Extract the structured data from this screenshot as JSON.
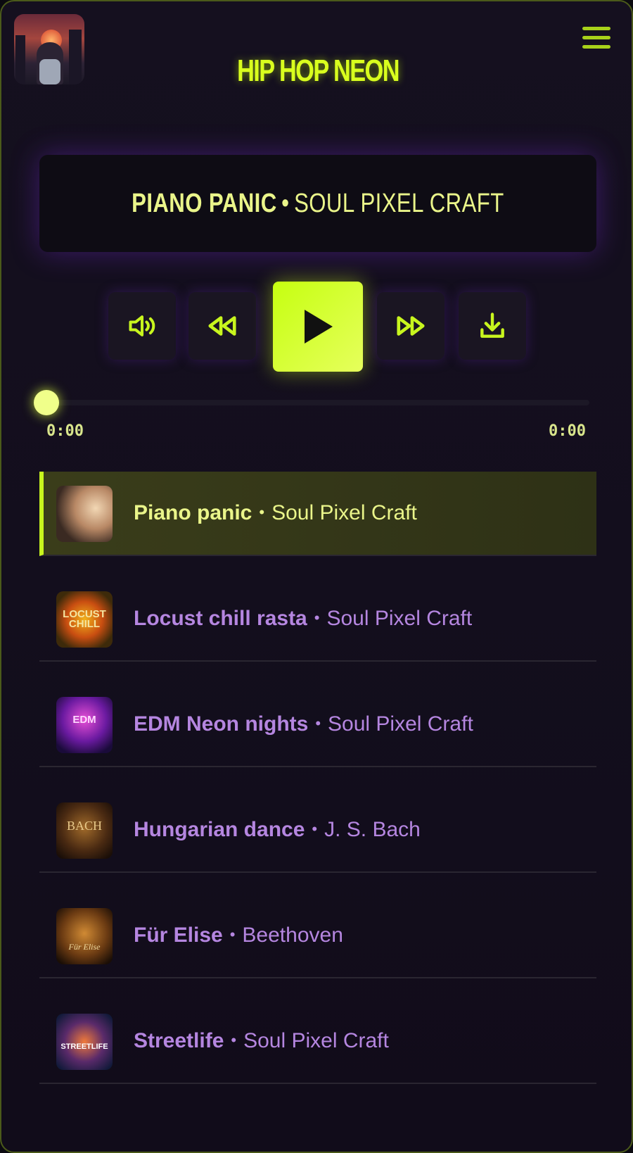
{
  "header": {
    "app_title": "HIP HOP NEON",
    "menu_icon": "hamburger-menu-icon",
    "avatar_icon": "album-art-city-girl"
  },
  "now_playing": {
    "title": "Piano panic",
    "separator": "•",
    "artist": "Soul Pixel Craft"
  },
  "controls": {
    "volume_icon": "volume-icon",
    "rewind_icon": "rewind-icon",
    "play_icon": "play-icon",
    "forward_icon": "fast-forward-icon",
    "download_icon": "download-icon",
    "accent": "#c8f51e"
  },
  "progress": {
    "elapsed": "0:00",
    "duration": "0:00",
    "fraction": 0
  },
  "playlist": [
    {
      "title": "Piano panic",
      "artist": "Soul Pixel Craft",
      "separator": "•",
      "active": true,
      "cover_text": ""
    },
    {
      "title": "Locust chill rasta",
      "artist": "Soul Pixel Craft",
      "separator": "•",
      "active": false,
      "cover_text": "LOCUST CHILL"
    },
    {
      "title": "EDM Neon nights",
      "artist": "Soul Pixel Craft",
      "separator": "•",
      "active": false,
      "cover_text": "EDM"
    },
    {
      "title": "Hungarian dance",
      "artist": "J. S. Bach",
      "separator": "•",
      "active": false,
      "cover_text": "BACH"
    },
    {
      "title": "Für Elise",
      "artist": "Beethoven",
      "separator": "•",
      "active": false,
      "cover_text": "Für Elise"
    },
    {
      "title": "Streetlife",
      "artist": "Soul Pixel Craft",
      "separator": "•",
      "active": false,
      "cover_text": "STREETLIFE"
    }
  ]
}
